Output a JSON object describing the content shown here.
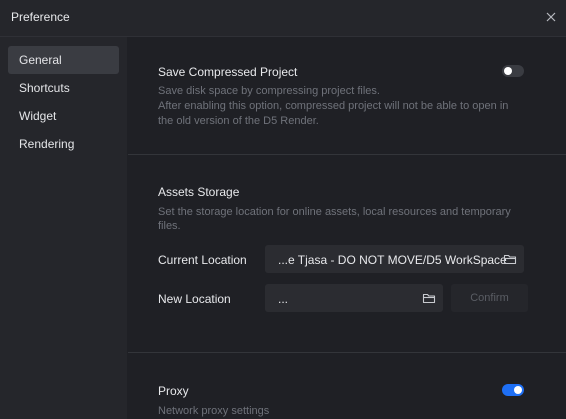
{
  "window": {
    "title": "Preference"
  },
  "sidebar": {
    "items": [
      {
        "label": "General",
        "active": true
      },
      {
        "label": "Shortcuts",
        "active": false
      },
      {
        "label": "Widget",
        "active": false
      },
      {
        "label": "Rendering",
        "active": false
      }
    ]
  },
  "sections": {
    "compressed": {
      "title": "Save Compressed Project",
      "desc_line1": "Save disk space by compressing project files.",
      "desc_line2": "After enabling this option, compressed project will not be able to open in",
      "desc_line3": "the old version of the D5 Render.",
      "enabled": false
    },
    "assets": {
      "title": "Assets Storage",
      "desc_line1": "Set the storage location for online assets, local resources and temporary",
      "desc_line2": "files.",
      "current_label": "Current Location",
      "current_value": "...e Tjasa - DO NOT MOVE/D5 WorkSpace",
      "new_label": "New Location",
      "new_value": "...",
      "confirm_label": "Confirm"
    },
    "proxy": {
      "title": "Proxy",
      "desc": "Network proxy settings",
      "enabled": true
    }
  },
  "colors": {
    "toggle_on": "#1e6ff5",
    "toggle_off": "#3a3c42",
    "background": "#1f2025",
    "sidebar": "#25262b"
  },
  "icons": {
    "close": "close-icon",
    "folder": "folder-icon"
  }
}
